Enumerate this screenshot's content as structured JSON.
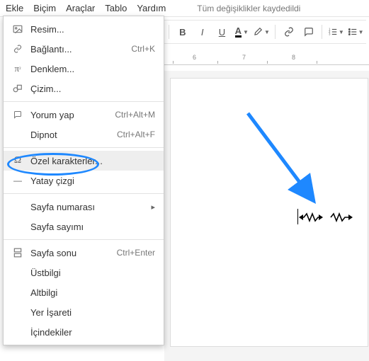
{
  "menubar": {
    "items": [
      "Ekle",
      "Biçim",
      "Araçlar",
      "Tablo",
      "Yardım"
    ],
    "saved": "Tüm değişiklikler kaydedildi"
  },
  "toolbar": {
    "bold": "B",
    "italic": "I",
    "underline": "U",
    "textcolor": "A"
  },
  "ruler": {
    "marks": [
      "6",
      "7",
      "8"
    ]
  },
  "menu": {
    "image": "Resim...",
    "link": "Bağlantı...",
    "link_shortcut": "Ctrl+K",
    "equation": "Denklem...",
    "drawing": "Çizim...",
    "comment": "Yorum yap",
    "comment_shortcut": "Ctrl+Alt+M",
    "footnote": "Dipnot",
    "footnote_shortcut": "Ctrl+Alt+F",
    "special": "Özel karakterler...",
    "hr": "Yatay çizgi",
    "pagenum": "Sayfa numarası",
    "pagecount": "Sayfa sayımı",
    "pagebreak": "Sayfa sonu",
    "pagebreak_shortcut": "Ctrl+Enter",
    "header": "Üstbilgi",
    "footer": "Altbilgi",
    "bookmark": "Yer İşareti",
    "toc": "İçindekiler"
  }
}
